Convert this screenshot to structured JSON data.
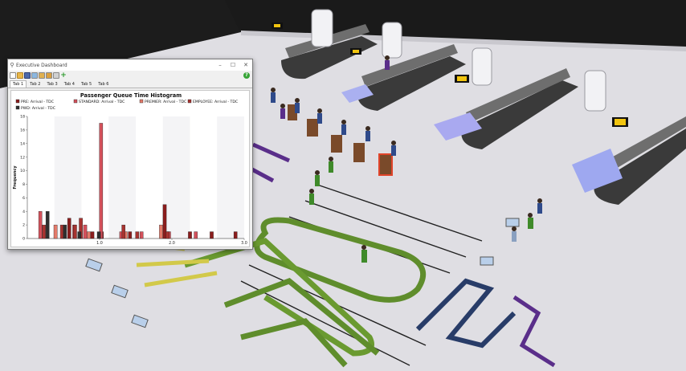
{
  "window": {
    "title": "Executive Dashboard",
    "title_icon": "app-icon",
    "controls": {
      "minimize": "–",
      "maximize": "☐",
      "close": "✕"
    }
  },
  "toolbar": {
    "icons": [
      "new-document-icon",
      "open-folder-icon",
      "save-icon",
      "export-image-icon",
      "folder-icon",
      "folder-open-icon",
      "copy-icon",
      "add-icon",
      "help-icon"
    ],
    "help_label": "?",
    "add_label": "+"
  },
  "tabs": [
    "Tab 1",
    "Tab 2",
    "Tab 3",
    "Tab 4",
    "Tab 5",
    "Tab 6"
  ],
  "active_tab": "Tab 1",
  "chart_data": {
    "type": "bar",
    "title": "Passenger Queue Time Histogram",
    "xlabel": "",
    "ylabel": "Frequency",
    "xlim": [
      0,
      3.0
    ],
    "ylim": [
      0,
      18
    ],
    "xticks": [
      "1.0",
      "2.0",
      "3.0"
    ],
    "yticks": [
      "0",
      "2",
      "4",
      "6",
      "8",
      "10",
      "12",
      "14",
      "16",
      "18"
    ],
    "grid": "alternating vertical bands",
    "legend_position": "top",
    "series": [
      {
        "name": "PRE: Arrival - TDC",
        "color": "#8b1d1d",
        "points": [
          [
            0.58,
            3
          ],
          [
            0.9,
            1
          ],
          [
            1.03,
            1
          ],
          [
            1.42,
            1
          ],
          [
            1.9,
            5
          ],
          [
            2.25,
            1
          ],
          [
            2.55,
            1
          ],
          [
            2.88,
            1
          ]
        ]
      },
      {
        "name": "STANDARD: Arrival - TDC",
        "color": "#d4515b",
        "points": [
          [
            0.18,
            4
          ],
          [
            0.65,
            2
          ],
          [
            0.8,
            2
          ],
          [
            1.02,
            17
          ],
          [
            1.3,
            1
          ],
          [
            1.58,
            1
          ],
          [
            1.96,
            1
          ],
          [
            2.33,
            1
          ]
        ]
      },
      {
        "name": "PREMIER: Arrival - TDC",
        "color": "#e37a6a",
        "points": [
          [
            0.39,
            2
          ],
          [
            0.85,
            1
          ],
          [
            1.36,
            1
          ],
          [
            1.85,
            2
          ]
        ]
      },
      {
        "name": "EMPLOYEE: Arrival - TDC",
        "color": "#a83330",
        "points": [
          [
            0.23,
            2
          ],
          [
            0.48,
            2
          ],
          [
            0.66,
            2
          ],
          [
            0.74,
            3
          ],
          [
            1.33,
            2
          ],
          [
            1.52,
            1
          ],
          [
            1.94,
            1
          ]
        ]
      },
      {
        "name": "PWD: Arrival - TDC",
        "color": "#2f2f2f",
        "points": [
          [
            0.28,
            4
          ],
          [
            0.52,
            2
          ],
          [
            0.72,
            1
          ],
          [
            0.99,
            1
          ]
        ]
      }
    ]
  }
}
